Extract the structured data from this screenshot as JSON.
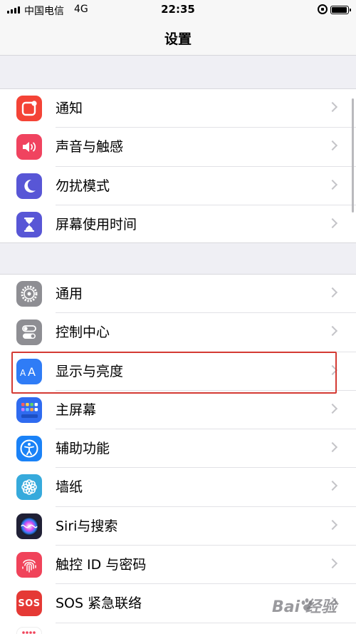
{
  "status_bar": {
    "carrier": "中国电信",
    "network": "4G",
    "time": "22:35",
    "battery_level": 0.95
  },
  "nav": {
    "title": "设置"
  },
  "groups": [
    {
      "items": [
        {
          "label": "通知",
          "icon": "notifications-icon",
          "color": "#f44336"
        },
        {
          "label": "声音与触感",
          "icon": "sounds-icon",
          "color": "#f0435f"
        },
        {
          "label": "勿扰模式",
          "icon": "moon-icon",
          "color": "#5856d6"
        },
        {
          "label": "屏幕使用时间",
          "icon": "hourglass-icon",
          "color": "#5856d6"
        }
      ]
    },
    {
      "items": [
        {
          "label": "通用",
          "icon": "gear-icon",
          "color": "#8e8e93"
        },
        {
          "label": "控制中心",
          "icon": "switches-icon",
          "color": "#8e8e93"
        },
        {
          "label": "显示与亮度",
          "icon": "text-size-icon",
          "color": "#2f7cf6",
          "highlighted": true
        },
        {
          "label": "主屏幕",
          "icon": "home-grid-icon",
          "color": "#2f6bf0"
        },
        {
          "label": "辅助功能",
          "icon": "accessibility-icon",
          "color": "#1a82f7"
        },
        {
          "label": "墙纸",
          "icon": "wallpaper-flower-icon",
          "color": "#36aadc"
        },
        {
          "label": "Siri与搜索",
          "icon": "siri-icon",
          "color": "#202036"
        },
        {
          "label": "触控 ID 与密码",
          "icon": "fingerprint-icon",
          "color": "#f0435a"
        },
        {
          "label": "SOS 紧急联络",
          "icon": "sos-icon",
          "color": "#e53935"
        }
      ]
    }
  ],
  "watermark": {
    "text": "Bai  经验"
  }
}
